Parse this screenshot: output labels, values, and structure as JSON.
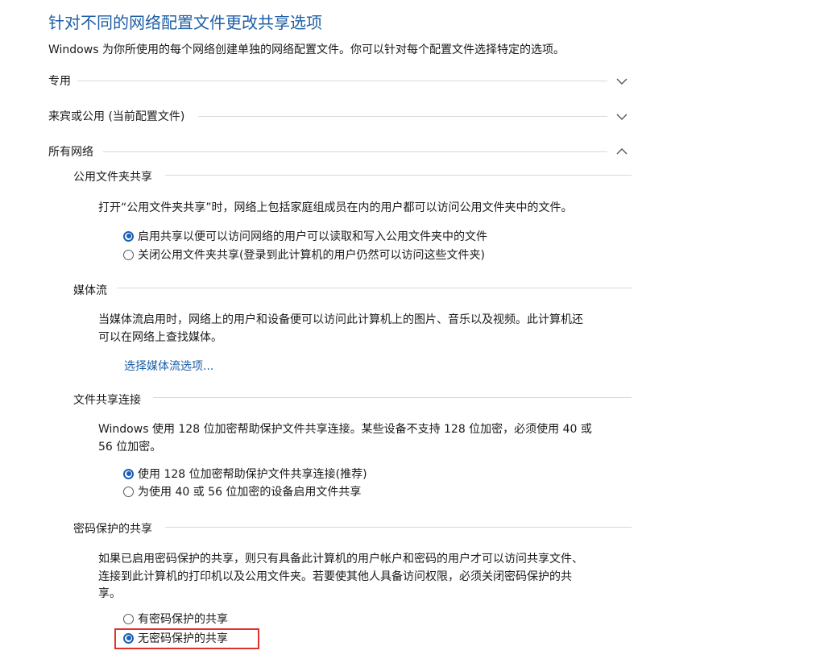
{
  "title": "针对不同的网络配置文件更改共享选项",
  "subtitle": "Windows 为你所使用的每个网络创建单独的网络配置文件。你可以针对每个配置文件选择特定的选项。",
  "profiles": [
    {
      "label": "专用",
      "expanded": false
    },
    {
      "label": "来宾或公用 (当前配置文件)",
      "expanded": false
    },
    {
      "label": "所有网络",
      "expanded": true
    }
  ],
  "public_folder": {
    "heading": "公用文件夹共享",
    "desc": "打开“公用文件夹共享”时，网络上包括家庭组成员在内的用户都可以访问公用文件夹中的文件。",
    "options": [
      {
        "label": "启用共享以便可以访问网络的用户可以读取和写入公用文件夹中的文件",
        "selected": true
      },
      {
        "label": "关闭公用文件夹共享(登录到此计算机的用户仍然可以访问这些文件夹)",
        "selected": false
      }
    ]
  },
  "media": {
    "heading": "媒体流",
    "desc_line1": "当媒体流启用时，网络上的用户和设备便可以访问此计算机上的图片、音乐以及视频。此计算机还",
    "desc_line2": "可以在网络上查找媒体。",
    "link": "选择媒体流选项..."
  },
  "file_sharing": {
    "heading": "文件共享连接",
    "desc_line1": "Windows 使用 128 位加密帮助保护文件共享连接。某些设备不支持 128 位加密，必须使用 40 或",
    "desc_line2": "56 位加密。",
    "options": [
      {
        "label": "使用 128 位加密帮助保护文件共享连接(推荐)",
        "selected": true
      },
      {
        "label": "为使用 40 或 56 位加密的设备启用文件共享",
        "selected": false
      }
    ]
  },
  "password": {
    "heading": "密码保护的共享",
    "desc_line1": "如果已启用密码保护的共享，则只有具备此计算机的用户帐户和密码的用户才可以访问共享文件、",
    "desc_line2": "连接到此计算机的打印机以及公用文件夹。若要使其他人具备访问权限，必须关闭密码保护的共",
    "desc_line3": "享。",
    "options": [
      {
        "label": "有密码保护的共享",
        "selected": false
      },
      {
        "label": "无密码保护的共享",
        "selected": true
      }
    ]
  },
  "colors": {
    "accent": "#1e5fa6",
    "radio": "#1b5fb6",
    "highlight": "#e0312b"
  }
}
